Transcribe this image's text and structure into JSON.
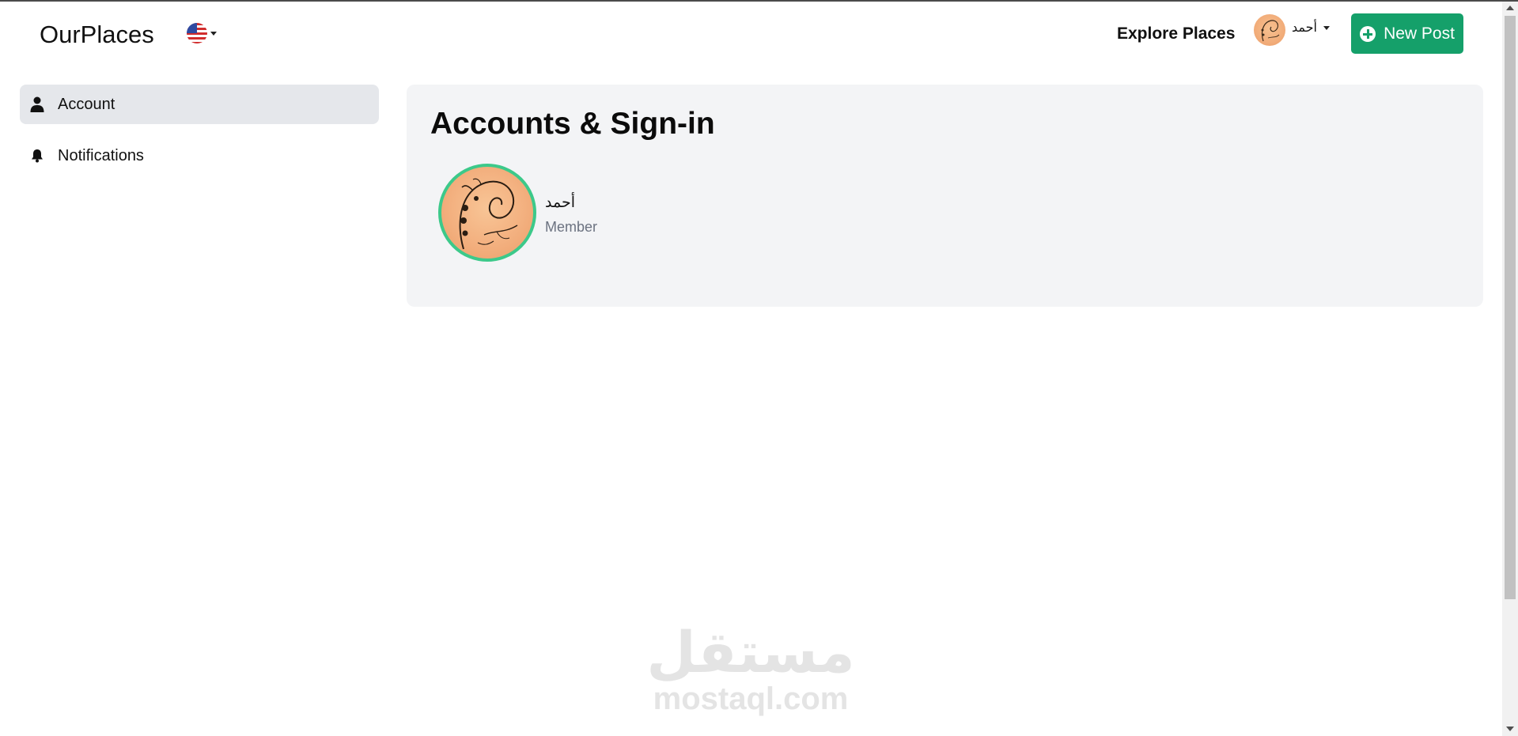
{
  "header": {
    "brand": "OurPlaces",
    "language_icon": "us-flag-icon",
    "explore_label": "Explore Places",
    "user_name": "أحمد",
    "new_post_label": "New Post",
    "accent_color": "#15a06a"
  },
  "sidebar": {
    "items": [
      {
        "label": "Account",
        "icon": "user-icon",
        "active": true
      },
      {
        "label": "Notifications",
        "icon": "bell-icon",
        "active": false
      }
    ]
  },
  "main": {
    "title": "Accounts & Sign-in",
    "profile": {
      "name": "أحمد",
      "role": "Member",
      "avatar_border_color": "#3cc98a"
    }
  },
  "watermark": {
    "arabic": "مستقل",
    "english": "mostaql.com"
  }
}
